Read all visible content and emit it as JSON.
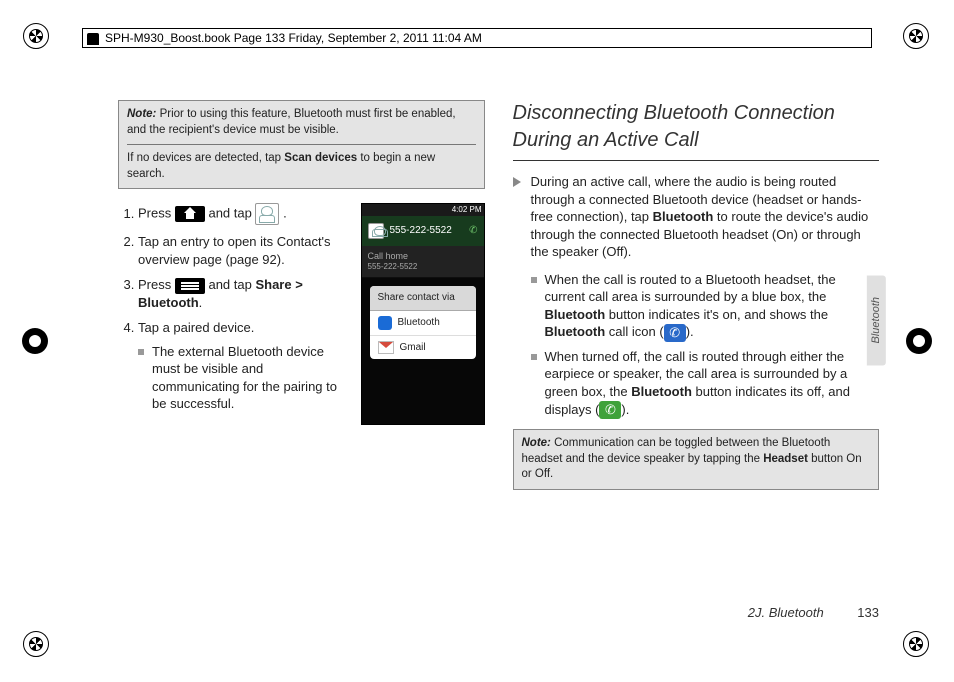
{
  "book_header": "SPH-M930_Boost.book  Page 133  Friday, September 2, 2011  11:04 AM",
  "left": {
    "note_label": "Note:",
    "note_text1": "Prior to using this feature, Bluetooth must first be enabled, and the recipient's device must be visible.",
    "note_text2_a": "If no devices are detected, tap ",
    "note_text2_bold": "Scan devices",
    "note_text2_b": " to begin a new search.",
    "step1_a": "Press ",
    "step1_b": " and tap ",
    "step1_c": " .",
    "step2": "Tap an entry to open its Contact's overview page (page 92).",
    "step3_a": "Press ",
    "step3_b": " and tap ",
    "step3_bold": "Share > Bluetooth",
    "step3_c": ".",
    "step4": "Tap a paired device.",
    "step4_sub": "The external Bluetooth device must be visible and communicating for the pairing to be successful."
  },
  "phone": {
    "status_time": "4:02 PM",
    "dial_number": "555-222-5522",
    "call_label": "Call home",
    "call_sub": "555-222-5522",
    "modal_title": "Share contact via",
    "row1": "Bluetooth",
    "row2": "Gmail"
  },
  "right": {
    "title": "Disconnecting Bluetooth Connection During an Active Call",
    "p1_a": "During an active call, where the audio is being routed through a connected Bluetooth device (headset or hands-free connection), tap ",
    "p1_bold": "Bluetooth",
    "p1_b": " to route the device's audio through the connected Bluetooth headset (On) or through the speaker (Off).",
    "b1_a": "When the call is routed to a Bluetooth headset, the current call area is surrounded by a blue box, the ",
    "b1_bold1": "Bluetooth",
    "b1_b": " button indicates it's on, and shows the ",
    "b1_bold2": "Bluetooth",
    "b1_c": " call icon (",
    "b1_d": ").",
    "b2_a": "When turned off, the call is routed through either the earpiece or speaker, the call area is surrounded by a green box, the ",
    "b2_bold": "Bluetooth",
    "b2_b": " button indicates its off, and displays (",
    "b2_c": ").",
    "note_label": "Note:",
    "note_text_a": "Communication can be toggled between the Bluetooth headset and the device speaker by tapping the ",
    "note_text_bold": "Headset",
    "note_text_b": " button On or Off.",
    "side_tab": "Bluetooth"
  },
  "footer": {
    "section": "2J. Bluetooth",
    "page": "133"
  }
}
